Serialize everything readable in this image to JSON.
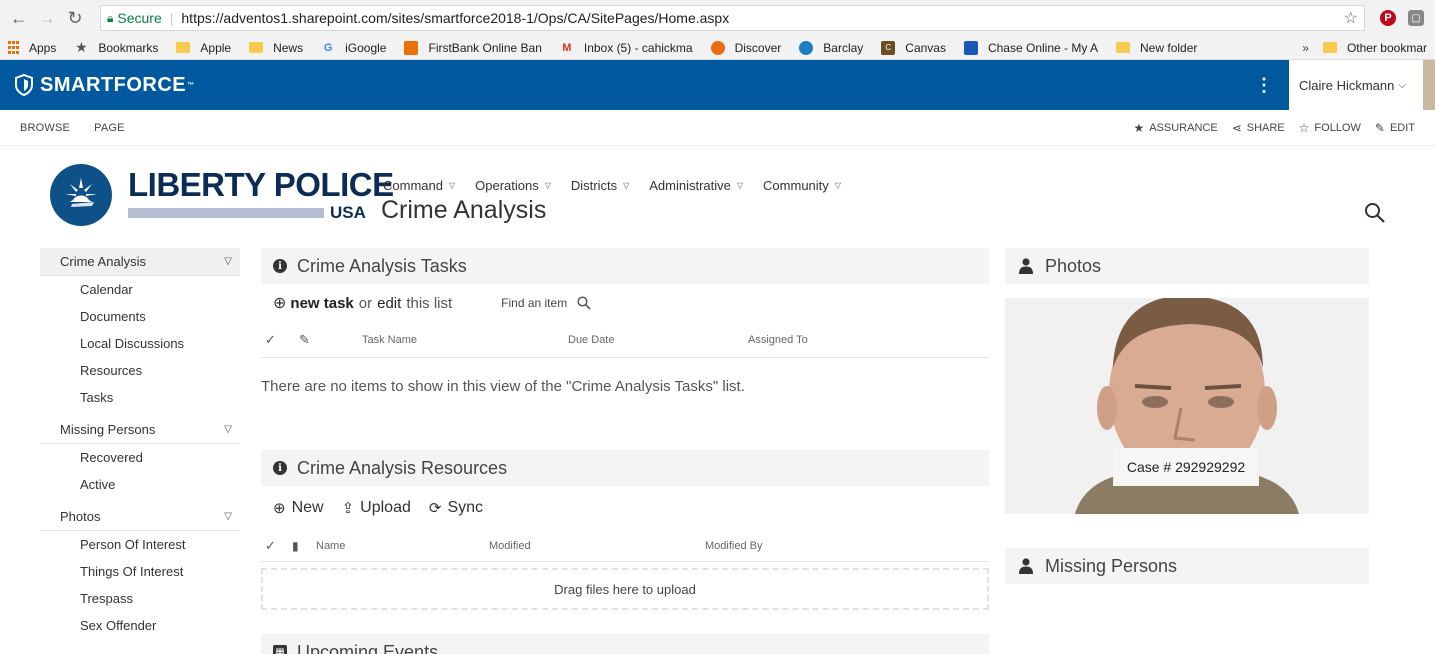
{
  "browser": {
    "secure_label": "Secure",
    "url": "https://adventos1.sharepoint.com/sites/smartforce2018-1/Ops/CA/SitePages/Home.aspx",
    "bookmarks": [
      "Apps",
      "Bookmarks",
      "Apple",
      "News",
      "iGoogle",
      "FirstBank Online Ban",
      "Inbox (5) - cahickma",
      "Discover",
      "Barclay",
      "Canvas",
      "Chase Online - My A",
      "New folder"
    ],
    "more_label": "»",
    "other_bookmarks": "Other bookmar"
  },
  "suitebar": {
    "brand": "SMARTFORCE",
    "tm": "™",
    "more": "⋮",
    "user_name": "Claire Hickmann"
  },
  "ribbon": {
    "tabs": [
      "BROWSE",
      "PAGE"
    ],
    "actions": [
      "ASSURANCE",
      "SHARE",
      "FOLLOW",
      "EDIT"
    ]
  },
  "header": {
    "logo_line1": "LIBERTY POLICE",
    "logo_line2": "USA",
    "nav": [
      "Command",
      "Operations",
      "Districts",
      "Administrative",
      "Community"
    ],
    "title": "Crime Analysis"
  },
  "leftnav": {
    "sections": [
      {
        "label": "Crime Analysis",
        "items": [
          "Calendar",
          "Documents",
          "Local Discussions",
          "Resources",
          "Tasks"
        ]
      },
      {
        "label": "Missing Persons",
        "items": [
          "Recovered",
          "Active"
        ]
      },
      {
        "label": "Photos",
        "items": [
          "Person Of Interest",
          "Things Of Interest",
          "Trespass",
          "Sex Offender"
        ]
      }
    ]
  },
  "tasks": {
    "title": "Crime Analysis Tasks",
    "new_task": "new task",
    "or": "or",
    "edit": "edit",
    "this_list": "this list",
    "find": "Find an item",
    "columns": [
      "Task Name",
      "Due Date",
      "Assigned To"
    ],
    "empty": "There are no items to show in this view of the \"Crime Analysis Tasks\" list."
  },
  "resources": {
    "title": "Crime Analysis Resources",
    "commands": [
      "New",
      "Upload",
      "Sync"
    ],
    "columns": [
      "Name",
      "Modified",
      "Modified By"
    ],
    "drop": "Drag files here to upload"
  },
  "events": {
    "title": "Upcoming Events"
  },
  "photos": {
    "title": "Photos",
    "caption": "Case # 292929292"
  },
  "missing": {
    "title": "Missing Persons"
  }
}
